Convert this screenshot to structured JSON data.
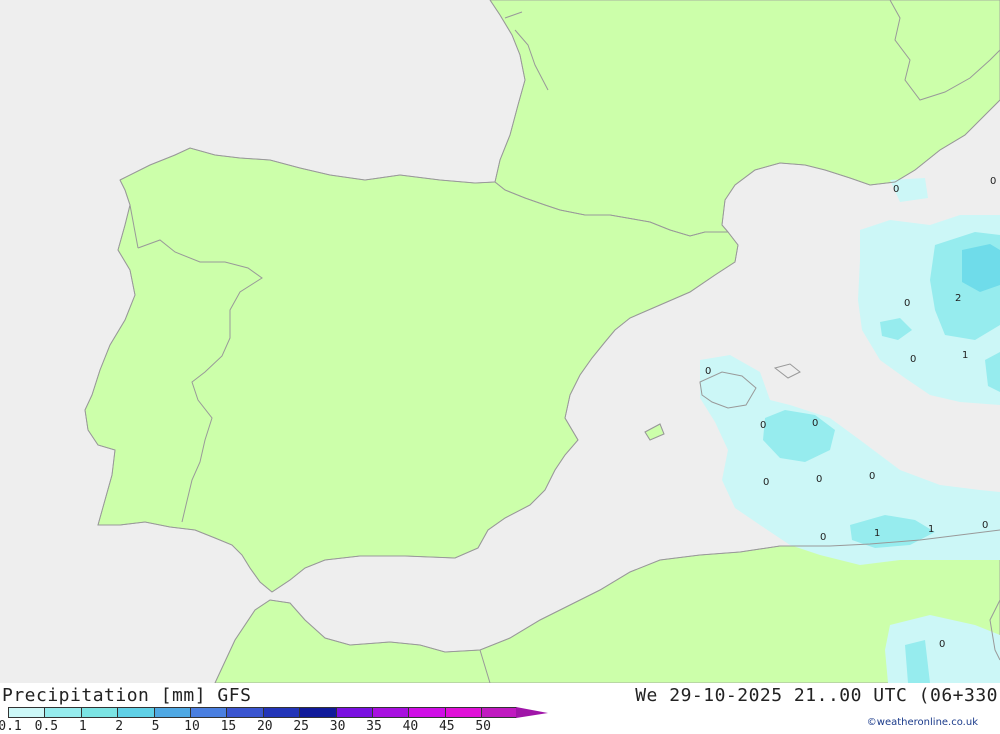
{
  "title": "Precipitation [mm] GFS",
  "datetime": "We 29-10-2025 21..00 UTC (06+330",
  "credit": "©weatheronline.co.uk",
  "colors": {
    "sea": "#eeeeee",
    "land": "#ccffaa",
    "coast": "#999999",
    "precip_light": "#ccf7f7",
    "precip_mid": "#96ecee",
    "precip_heavy": "#6fdcea"
  },
  "legend": {
    "ticks": [
      "0.1",
      "0.5",
      "1",
      "2",
      "5",
      "10",
      "15",
      "20",
      "25",
      "30",
      "35",
      "40",
      "45",
      "50"
    ],
    "colors": [
      "#ccf7f7",
      "#96ecee",
      "#7be3e3",
      "#5fd0e6",
      "#4fa8e3",
      "#4a7fe0",
      "#3a55d0",
      "#2335b8",
      "#101a9a",
      "#7a10e0",
      "#a810e0",
      "#d00ee6",
      "#e010d8",
      "#c01ac0"
    ],
    "arrow_color": "#a015a8"
  },
  "contour_labels": [
    "0",
    "0",
    "0",
    "2",
    "0",
    "1",
    "0",
    "0",
    "0",
    "0",
    "0",
    "0",
    "0",
    "1",
    "1",
    "0",
    "0"
  ]
}
